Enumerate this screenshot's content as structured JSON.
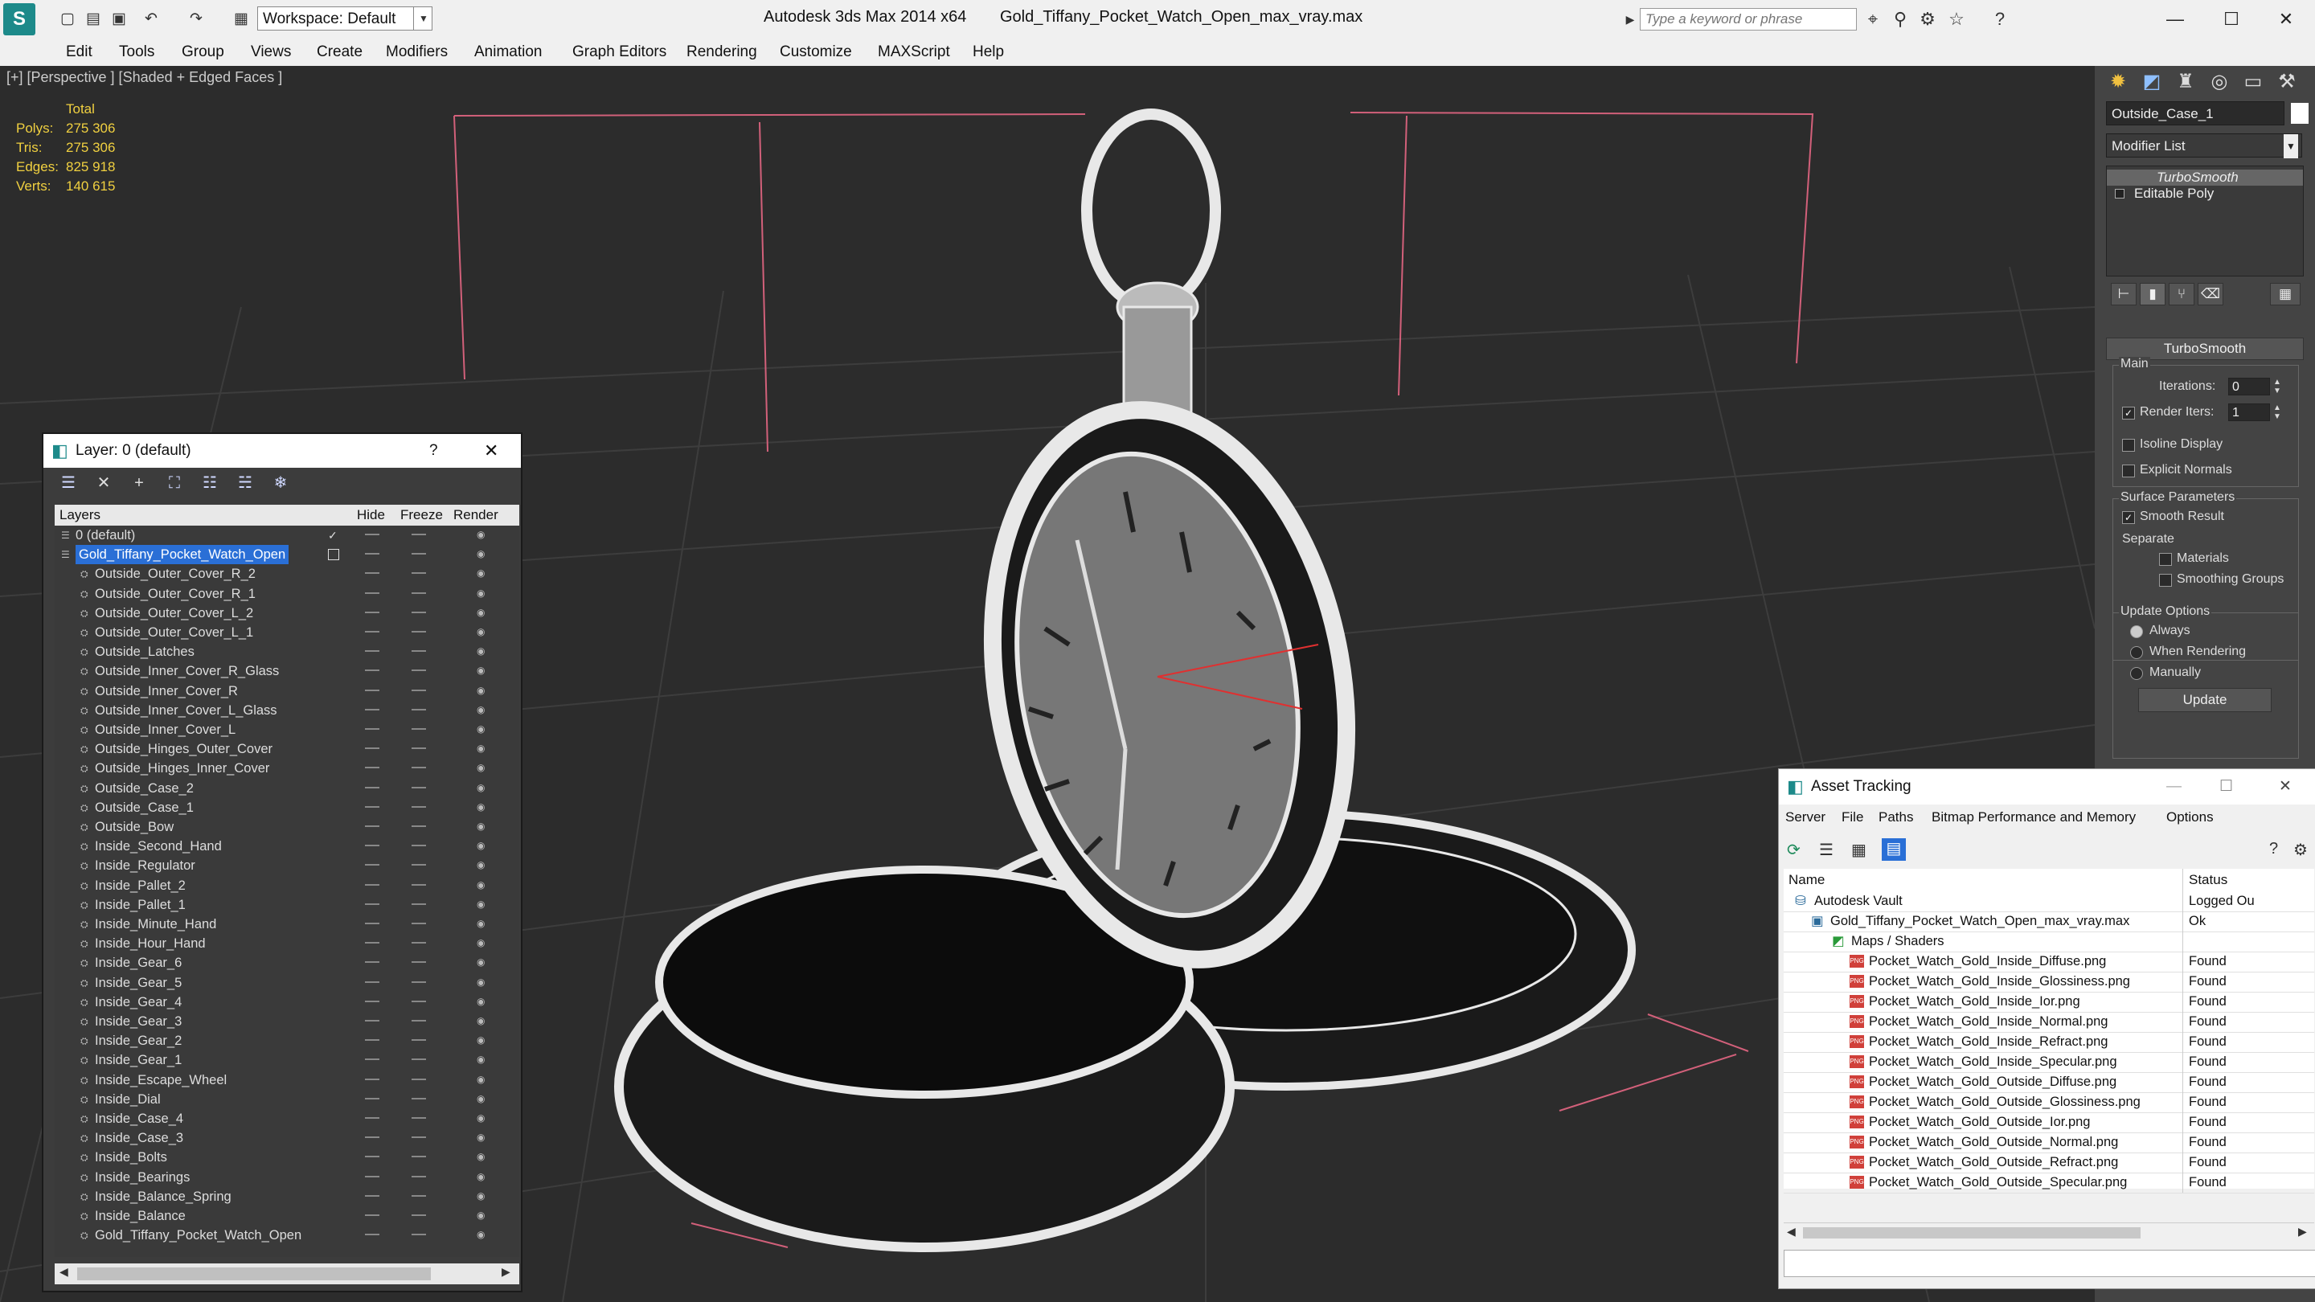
{
  "titlebar": {
    "app": "Autodesk 3ds Max  2014 x64",
    "file": "Gold_Tiffany_Pocket_Watch_Open_max_vray.max",
    "workspace": "Workspace: Default",
    "search_placeholder": "Type a keyword or phrase"
  },
  "menu": [
    "Edit",
    "Tools",
    "Group",
    "Views",
    "Create",
    "Modifiers",
    "Animation",
    "Graph Editors",
    "Rendering",
    "Customize",
    "MAXScript",
    "Help"
  ],
  "viewport": {
    "label": "[+] [Perspective ] [Shaded + Edged Faces ]",
    "stats": {
      "header": "Total",
      "rows": [
        {
          "k": "Polys:",
          "v": "275 306"
        },
        {
          "k": "Tris:",
          "v": "275 306"
        },
        {
          "k": "Edges:",
          "v": "825 918"
        },
        {
          "k": "Verts:",
          "v": "140 615"
        }
      ]
    }
  },
  "cmdpanel": {
    "object_name": "Outside_Case_1",
    "modifier_list": "Modifier List",
    "stack": [
      "TurboSmooth",
      "Editable Poly"
    ],
    "rollout": "TurboSmooth",
    "main": "Main",
    "iterations_label": "Iterations:",
    "iterations": "0",
    "render_iters_label": "Render Iters:",
    "render_iters": "1",
    "isoline": "Isoline Display",
    "explicit": "Explicit Normals",
    "surface": "Surface Parameters",
    "smooth_result": "Smooth Result",
    "separate": "Separate",
    "materials": "Materials",
    "smoothing_groups": "Smoothing Groups",
    "update_options": "Update Options",
    "always": "Always",
    "when_rendering": "When Rendering",
    "manually": "Manually",
    "update_btn": "Update"
  },
  "layers": {
    "title": "Layer: 0 (default)",
    "help": "?",
    "cols": {
      "layers": "Layers",
      "hide": "Hide",
      "freeze": "Freeze",
      "render": "Render"
    },
    "rows": [
      "0 (default)",
      "Gold_Tiffany_Pocket_Watch_Open",
      "Outside_Outer_Cover_R_2",
      "Outside_Outer_Cover_R_1",
      "Outside_Outer_Cover_L_2",
      "Outside_Outer_Cover_L_1",
      "Outside_Latches",
      "Outside_Inner_Cover_R_Glass",
      "Outside_Inner_Cover_R",
      "Outside_Inner_Cover_L_Glass",
      "Outside_Inner_Cover_L",
      "Outside_Hinges_Outer_Cover",
      "Outside_Hinges_Inner_Cover",
      "Outside_Case_2",
      "Outside_Case_1",
      "Outside_Bow",
      "Inside_Second_Hand",
      "Inside_Regulator",
      "Inside_Pallet_2",
      "Inside_Pallet_1",
      "Inside_Minute_Hand",
      "Inside_Hour_Hand",
      "Inside_Gear_6",
      "Inside_Gear_5",
      "Inside_Gear_4",
      "Inside_Gear_3",
      "Inside_Gear_2",
      "Inside_Gear_1",
      "Inside_Escape_Wheel",
      "Inside_Dial",
      "Inside_Case_4",
      "Inside_Case_3",
      "Inside_Bolts",
      "Inside_Bearings",
      "Inside_Balance_Spring",
      "Inside_Balance",
      "Gold_Tiffany_Pocket_Watch_Open"
    ]
  },
  "asset": {
    "title": "Asset Tracking",
    "menu": [
      "Server",
      "File",
      "Paths",
      "Bitmap Performance and Memory",
      "Options"
    ],
    "cols": {
      "name": "Name",
      "status": "Status"
    },
    "rows": [
      {
        "name": "Autodesk Vault",
        "status": "Logged Ou"
      },
      {
        "name": "Gold_Tiffany_Pocket_Watch_Open_max_vray.max",
        "status": "Ok"
      },
      {
        "name": "Maps / Shaders",
        "status": ""
      },
      {
        "name": "Pocket_Watch_Gold_Inside_Diffuse.png",
        "status": "Found"
      },
      {
        "name": "Pocket_Watch_Gold_Inside_Glossiness.png",
        "status": "Found"
      },
      {
        "name": "Pocket_Watch_Gold_Inside_Ior.png",
        "status": "Found"
      },
      {
        "name": "Pocket_Watch_Gold_Inside_Normal.png",
        "status": "Found"
      },
      {
        "name": "Pocket_Watch_Gold_Inside_Refract.png",
        "status": "Found"
      },
      {
        "name": "Pocket_Watch_Gold_Inside_Specular.png",
        "status": "Found"
      },
      {
        "name": "Pocket_Watch_Gold_Outside_Diffuse.png",
        "status": "Found"
      },
      {
        "name": "Pocket_Watch_Gold_Outside_Glossiness.png",
        "status": "Found"
      },
      {
        "name": "Pocket_Watch_Gold_Outside_Ior.png",
        "status": "Found"
      },
      {
        "name": "Pocket_Watch_Gold_Outside_Normal.png",
        "status": "Found"
      },
      {
        "name": "Pocket_Watch_Gold_Outside_Refract.png",
        "status": "Found"
      },
      {
        "name": "Pocket_Watch_Gold_Outside_Specular.png",
        "status": "Found"
      }
    ]
  }
}
